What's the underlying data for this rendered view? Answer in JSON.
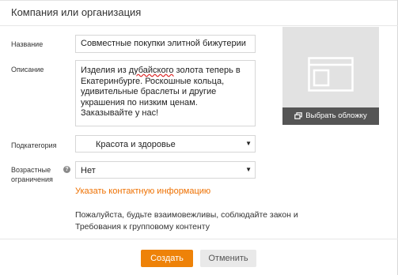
{
  "dialog": {
    "title": "Компания или организация"
  },
  "form": {
    "name": {
      "label": "Название",
      "value": "Совместные покупки элитной бижутерии"
    },
    "description": {
      "label": "Описание",
      "value_part1": "Изделия из ",
      "value_misspelled": "дубайского",
      "value_part2": " золота теперь в Екатеринбурге. Роскошные кольца, удивительные браслеты и другие украшения по низким ценам. Заказывайте у нас!"
    },
    "subcategory": {
      "label": "Подкатегория",
      "value": "Красота и здоровье"
    },
    "age": {
      "label_line1": "Возрастные",
      "label_line2": "ограничения",
      "value": "Нет",
      "help_icon": "?"
    },
    "contact_link": "Указать контактную информацию",
    "notice_line1": "Пожалуйста, будьте взаимовежливы, соблюдайте закон и",
    "notice_line2": "Требования к групповому контенту"
  },
  "cover": {
    "button_label": "Выбрать обложку"
  },
  "buttons": {
    "create": "Создать",
    "cancel": "Отменить"
  },
  "colors": {
    "accent": "#ee8208",
    "link": "#ee7000",
    "cover_bg": "#e2e2e2",
    "cover_button_bg": "#555555"
  }
}
